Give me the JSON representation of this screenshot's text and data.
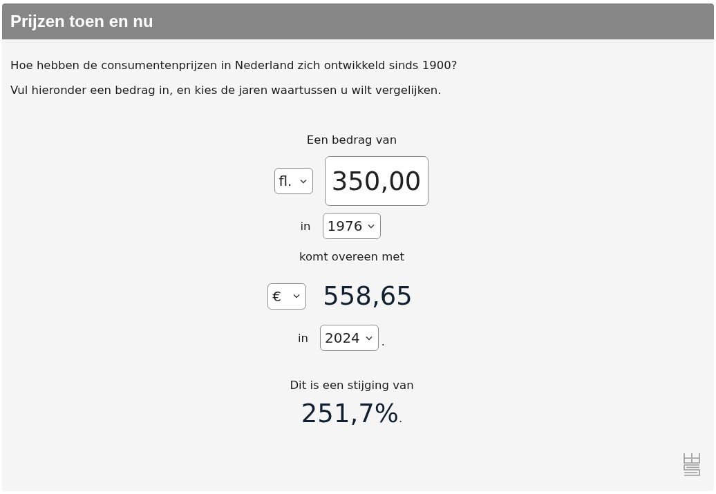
{
  "title": "Prijzen toen en nu",
  "intro": [
    "Hoe hebben de consumentenprijzen in Nederland zich ontwikkeld sinds 1900?",
    "Vul hieronder een bedrag in, en kies de jaren waartussen u wilt vergelijken."
  ],
  "amount_label": "Een bedrag van",
  "from_currency": "fl.",
  "amount": "350,00",
  "from_in": "in",
  "from_year": "1976",
  "result_label": "komt overeen met",
  "to_currency": "€",
  "result": "558,65",
  "to_in": "in",
  "to_year": "2024",
  "to_period": ".",
  "change_label": "Dit is een stijging van",
  "change": "251,7%",
  "change_period": "."
}
